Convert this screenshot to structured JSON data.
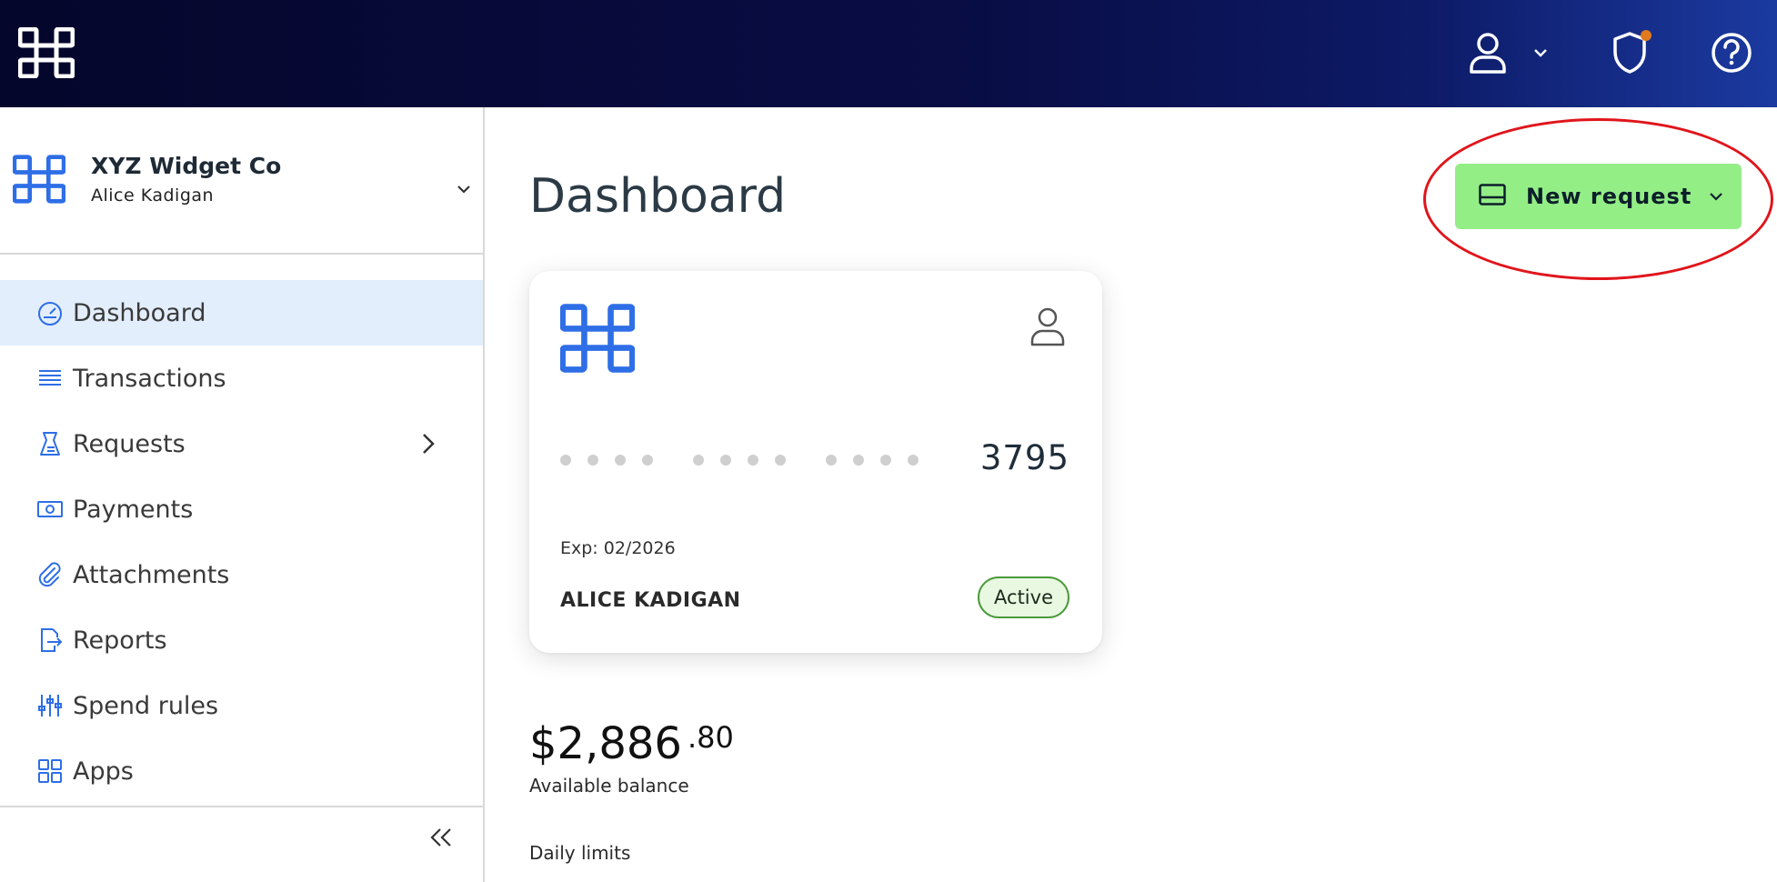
{
  "topbar": {
    "logo_icon": "app-logo-icon",
    "user_icon": "user-icon",
    "user_menu_icon": "chevron-down-icon",
    "security_icon": "shield-icon",
    "security_notification_color": "#e07a1f",
    "help_icon": "help-icon"
  },
  "sidebar": {
    "org": {
      "name": "XYZ Widget Co",
      "user": "Alice Kadigan"
    },
    "items": [
      {
        "label": "Dashboard",
        "icon": "gauge-icon",
        "active": true
      },
      {
        "label": "Transactions",
        "icon": "list-icon"
      },
      {
        "label": "Requests",
        "icon": "requests-icon",
        "has_submenu": true
      },
      {
        "label": "Payments",
        "icon": "money-icon"
      },
      {
        "label": "Attachments",
        "icon": "paperclip-icon"
      },
      {
        "label": "Reports",
        "icon": "export-icon"
      },
      {
        "label": "Spend rules",
        "icon": "sliders-icon"
      },
      {
        "label": "Apps",
        "icon": "grid-icon"
      }
    ],
    "collapse_icon": "double-chevron-left-icon"
  },
  "main": {
    "title": "Dashboard",
    "new_request_label": "New request",
    "accent_color": "#93ee86",
    "card": {
      "last4": "3795",
      "expiry": "Exp: 02/2026",
      "holder": "ALICE KADIGAN",
      "status": "Active"
    },
    "balance": {
      "dollars": "$2,886",
      "cents": ".80",
      "label": "Available balance"
    },
    "daily_limits_label": "Daily limits"
  },
  "colors": {
    "brand_blue": "#2e6ee6",
    "active_nav_bg": "#e3eefc",
    "highlight_ring": "#e0151b"
  }
}
